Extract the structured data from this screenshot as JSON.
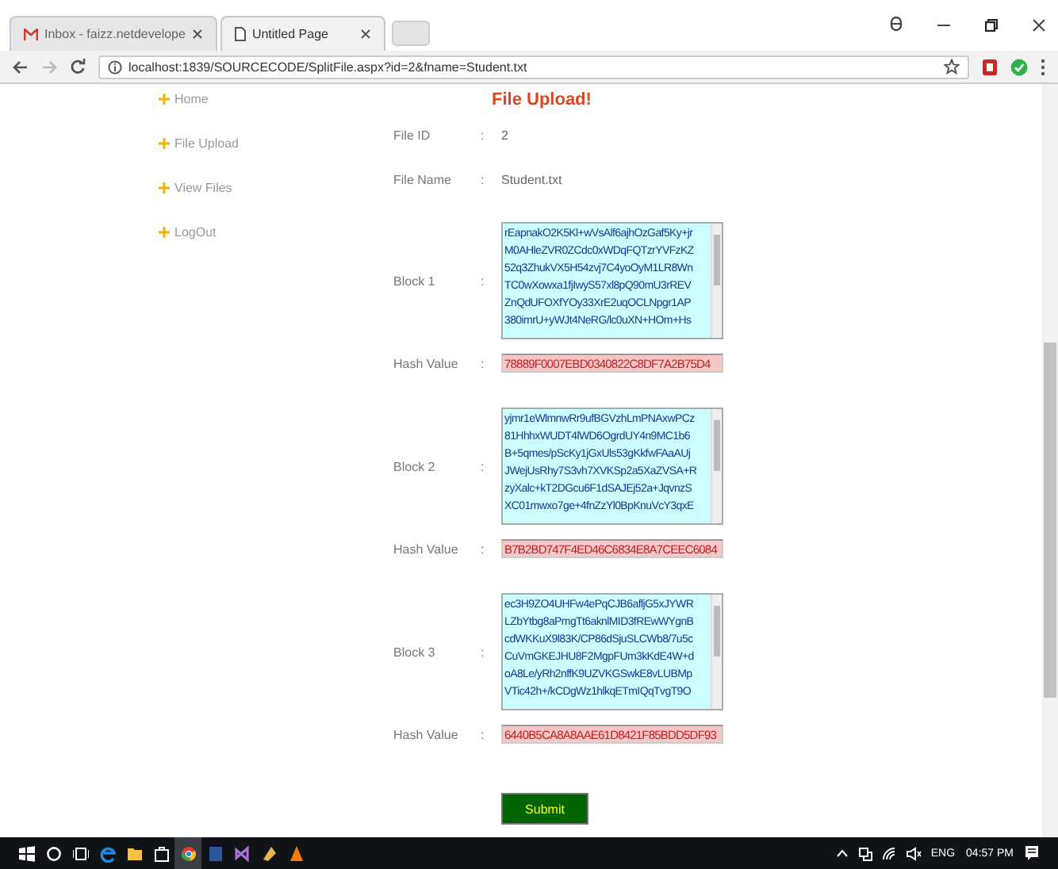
{
  "browser": {
    "tabs": [
      {
        "label": "Inbox - faizz.netdevelope",
        "selected": false
      },
      {
        "label": "Untitled Page",
        "selected": true
      }
    ],
    "url": "localhost:1839/SOURCECODE/SplitFile.aspx?id=2&fname=Student.txt"
  },
  "sidebar": {
    "items": [
      {
        "label": "Home"
      },
      {
        "label": "File Upload"
      },
      {
        "label": "View Files"
      },
      {
        "label": "LogOut"
      }
    ]
  },
  "title": "File Upload!",
  "rows": [
    {
      "kind": "text",
      "label": "File ID",
      "value": "2"
    },
    {
      "kind": "text",
      "label": "File Name",
      "value": "Student.txt"
    },
    {
      "kind": "block",
      "label": "Block 1",
      "value": "rEapnakO2K5Kl+wVsAlf6ajhOzGaf5Ky+jr\nM0AHleZVR0ZCdc0xWDqFQTzrYVFzKZ\n52q3ZhukVX5H54zvj7C4yoOyM1LR8Wn\nTC0wXowxa1fjIwyS57xl8pQ90mU3rREV\nZnQdUFOXfYOy33XrE2uqOCLNpgr1AP\n380imrU+yWJt4NeRG/lc0uXN+HOm+Hs"
    },
    {
      "kind": "hash",
      "label": "Hash Value",
      "value": "78889F0007EBD0340822C8DF7A2B75D4"
    },
    {
      "kind": "block",
      "label": "Block 2",
      "value": "yjmr1eWlmnwRr9ufBGVzhLmPNAxwPCz\n81HhhxWUDT4lWD6OgrdUY4n9MC1b6\nB+5qmes/pScKy1jGxUls53gKkfwFAaAUj\nJWejUsRhy7S3vh7XVKSp2a5XaZVSA+R\nzyXalc+kT2DGcu6F1dSAJEj52a+JqvnzS\nXC01mwxo7ge+4fnZzYl0BpKnuVcY3qxE"
    },
    {
      "kind": "hash",
      "label": "Hash Value",
      "value": "B7B2BD747F4ED46C6834E8A7CEEC6084"
    },
    {
      "kind": "block",
      "label": "Block 3",
      "value": "ec3H9ZO4UHFw4ePqCJB6afljG5xJYWR\nLZbYtbg8aPmgTt6aknlMID3fREwWYgnB\ncdWKKuX9l83K/CP86dSjuSLCWb8/7u5c\nCuVmGKEJHU8F2MgpFUm3kKdE4W+d\noA8Le/yRh2nffK9UZVKGSwkE8vLUBMp\nVTic42h+/kCDgWz1hlkqETmIQqTvgT9O"
    },
    {
      "kind": "hash",
      "label": "Hash Value",
      "value": "6440B5CA8A8AAE61D8421F85BDD5DF93"
    }
  ],
  "separator": ":",
  "submit": "Submit",
  "taskbar": {
    "language": "ENG",
    "time": "04:57 PM"
  }
}
